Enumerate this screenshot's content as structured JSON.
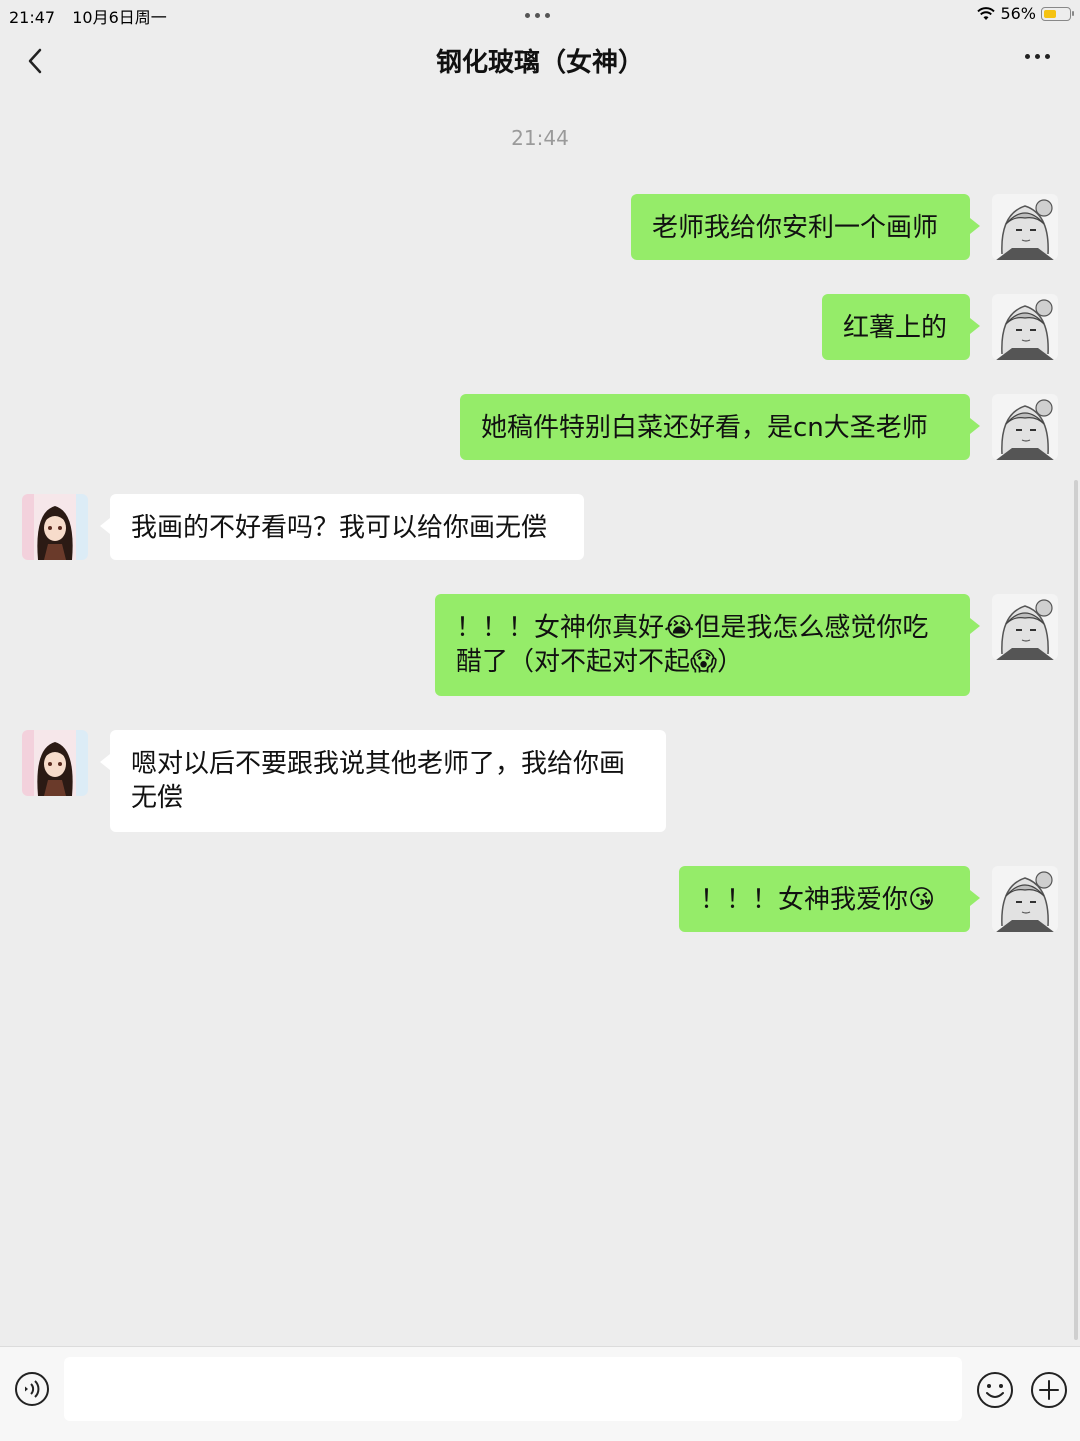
{
  "status_bar": {
    "time": "21:47",
    "date": "10月6日周一",
    "battery": "56%",
    "battery_level": 0.56
  },
  "nav": {
    "title": "钢化玻璃（女神）"
  },
  "chat": {
    "timestamp": "21:44",
    "messages": [
      {
        "side": "out",
        "text": "老师我给你安利一个画师"
      },
      {
        "side": "out",
        "text": "红薯上的"
      },
      {
        "side": "out",
        "text": "她稿件特别白菜还好看，是cn大圣老师"
      },
      {
        "side": "in",
        "text": "我画的不好看吗？我可以给你画无偿"
      },
      {
        "side": "out",
        "text": "！！！女神你真好😭但是我怎么感觉你吃醋了（对不起对不起😱）"
      },
      {
        "side": "in",
        "text": "嗯对以后不要跟我说其他老师了，我给你画无偿"
      },
      {
        "side": "out",
        "text": "！！！女神我爱你😘"
      }
    ]
  },
  "input": {
    "placeholder": ""
  },
  "colors": {
    "outgoing_bubble": "#95ec69",
    "incoming_bubble": "#ffffff",
    "background": "#ededed"
  }
}
